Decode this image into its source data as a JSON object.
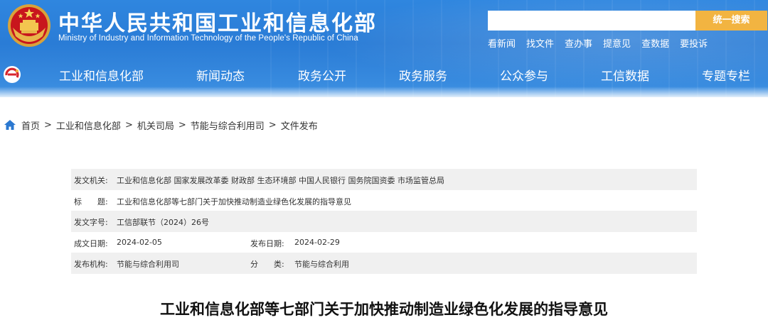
{
  "header": {
    "emblem_icon": "national-emblem-icon",
    "title": "中华人民共和国工业和信息化部",
    "subtitle": "Ministry of Industry and Information Technology of the People's Republic of China",
    "colors": {
      "bar": "#2f86df",
      "search_button": "#f2b441"
    }
  },
  "search": {
    "value": "",
    "placeholder": "",
    "button_label": "统一搜索"
  },
  "quick_links": [
    "看新闻",
    "找文件",
    "查办事",
    "提意见",
    "查数据",
    "要投诉"
  ],
  "nav": {
    "logo_icon": "miit-logo-icon",
    "items": [
      "工业和信息化部",
      "新闻动态",
      "政务公开",
      "政务服务",
      "公众参与",
      "工信数据",
      "专题专栏"
    ]
  },
  "breadcrumb": {
    "icon": "home-icon",
    "items": [
      "首页",
      "工业和信息化部",
      "机关司局",
      "节能与综合利用司",
      "文件发布"
    ],
    "separator": ">"
  },
  "meta": {
    "issuer_label": "发文机关:",
    "issuer_value": "工业和信息化部 国家发展改革委 财政部 生态环境部 中国人民银行 国务院国资委 市场监管总局",
    "title_label": "标　　题:",
    "title_value": "工业和信息化部等七部门关于加快推动制造业绿色化发展的指导意见",
    "doc_no_label": "发文字号:",
    "doc_no_value": "工信部联节（2024）26号",
    "created_label": "成文日期:",
    "created_value": "2024-02-05",
    "published_label": "发布日期:",
    "published_value": "2024-02-29",
    "org_label": "发布机构:",
    "org_value": "节能与综合利用司",
    "category_label": "分　　类:",
    "category_value": "节能与综合利用"
  },
  "document": {
    "title": "工业和信息化部等七部门关于加快推动制造业绿色化发展的指导意见"
  }
}
